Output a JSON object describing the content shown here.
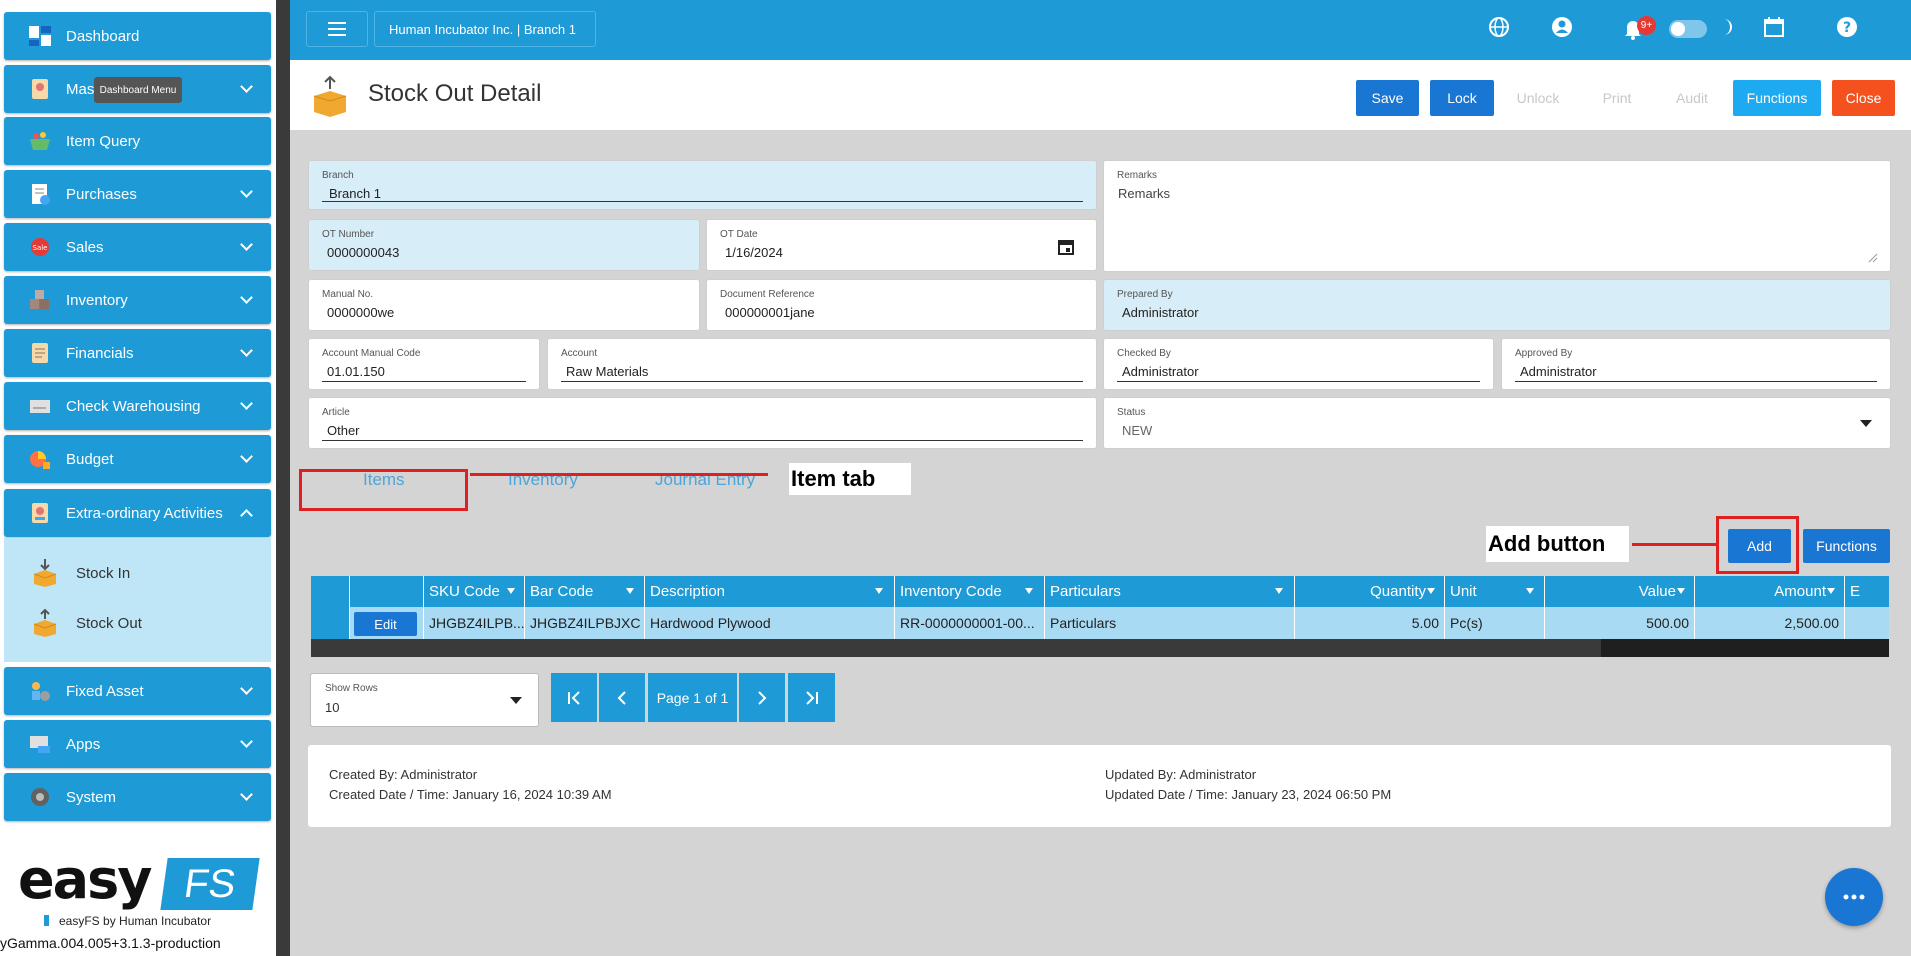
{
  "sidebar": {
    "tooltip": "Dashboard Menu",
    "items": [
      {
        "label": "Dashboard",
        "icon": "dashboard-icon"
      },
      {
        "label": "Mast",
        "icon": "master-data-icon"
      },
      {
        "label": "Item Query",
        "icon": "basket-icon"
      },
      {
        "label": "Purchases",
        "icon": "purchases-icon"
      },
      {
        "label": "Sales",
        "icon": "sale-tag-icon"
      },
      {
        "label": "Inventory",
        "icon": "boxes-icon"
      },
      {
        "label": "Financials",
        "icon": "financials-icon"
      },
      {
        "label": "Check Warehousing",
        "icon": "check-icon"
      },
      {
        "label": "Budget",
        "icon": "budget-icon"
      },
      {
        "label": "Extra-ordinary Activities",
        "icon": "activities-icon"
      },
      {
        "label": "Fixed Asset",
        "icon": "fixed-asset-icon"
      },
      {
        "label": "Apps",
        "icon": "apps-icon"
      },
      {
        "label": "System",
        "icon": "system-gear-icon"
      }
    ],
    "submenu": [
      {
        "label": "Stock In",
        "icon": "stock-in-box-icon"
      },
      {
        "label": "Stock Out",
        "icon": "stock-out-box-icon"
      }
    ],
    "logo": {
      "easy": "easy",
      "fs": "FS",
      "by": "easyFS by Human Incubator"
    },
    "version": "yGamma.004.005+3.1.3-production"
  },
  "topbar": {
    "branch": "Human Incubator Inc. | Branch 1",
    "notification_count": "9+"
  },
  "header": {
    "title": "Stock Out Detail",
    "buttons": {
      "save": "Save",
      "lock": "Lock",
      "unlock": "Unlock",
      "print": "Print",
      "audit": "Audit",
      "functions": "Functions",
      "close": "Close"
    }
  },
  "form": {
    "branch": {
      "label": "Branch",
      "value": "Branch 1"
    },
    "remarks": {
      "label": "Remarks",
      "value": "Remarks"
    },
    "ot_number": {
      "label": "OT Number",
      "value": "0000000043"
    },
    "ot_date": {
      "label": "OT Date",
      "value": "1/16/2024"
    },
    "manual_no": {
      "label": "Manual No.",
      "value": "0000000we"
    },
    "doc_ref": {
      "label": "Document Reference",
      "value": "000000001jane"
    },
    "prepared_by": {
      "label": "Prepared By",
      "value": "Administrator"
    },
    "acct_manual_code": {
      "label": "Account Manual Code",
      "value": "01.01.150"
    },
    "account": {
      "label": "Account",
      "value": "Raw Materials"
    },
    "checked_by": {
      "label": "Checked By",
      "value": "Administrator"
    },
    "approved_by": {
      "label": "Approved By",
      "value": "Administrator"
    },
    "article": {
      "label": "Article",
      "value": "Other"
    },
    "status": {
      "label": "Status",
      "value": "NEW"
    }
  },
  "tabs": {
    "items": "Items",
    "inventory": "Inventory",
    "journal": "Journal Entry"
  },
  "annotations": {
    "item_tab": "Item tab",
    "add_button": "Add button"
  },
  "grid_buttons": {
    "add": "Add",
    "functions": "Functions",
    "edit": "Edit"
  },
  "grid": {
    "columns": [
      "SKU Code",
      "Bar Code",
      "Description",
      "Inventory Code",
      "Particulars",
      "Quantity",
      "Unit",
      "Value",
      "Amount",
      "E"
    ],
    "row": {
      "sku": "JHGBZ4ILPB...",
      "bar": "JHGBZ4ILPBJXC",
      "desc": "Hardwood Plywood",
      "inv": "RR-0000000001-00...",
      "part": "Particulars",
      "qty": "5.00",
      "unit": "Pc(s)",
      "value": "500.00",
      "amount": "2,500.00"
    }
  },
  "pager": {
    "show_rows_label": "Show Rows",
    "show_rows_value": "10",
    "page_text": "Page 1 of 1"
  },
  "audit": {
    "created_by": "Created By: Administrator",
    "created_date": "Created Date / Time: January 16, 2024 10:39 AM",
    "updated_by": "Updated By: Administrator",
    "updated_date": "Updated Date / Time: January 23, 2024 06:50 PM"
  },
  "colors": {
    "primary": "#1e9bd7",
    "button": "#1976d2",
    "danger": "#f4511e",
    "annotation": "#e02020"
  }
}
